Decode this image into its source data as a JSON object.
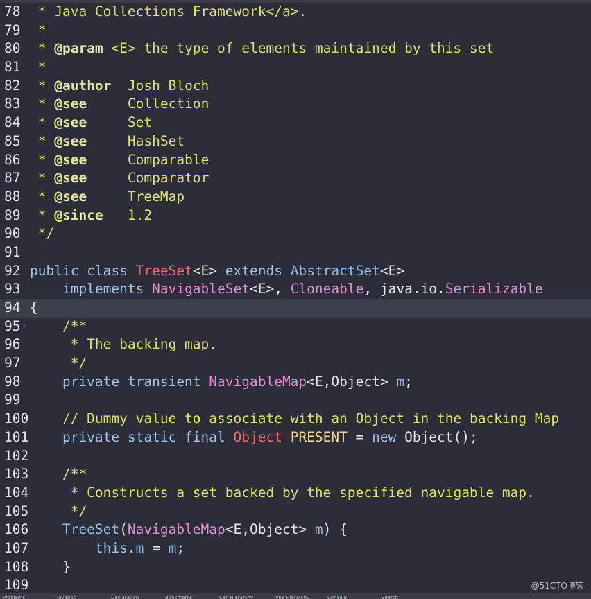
{
  "editor": {
    "lines": [
      {
        "num": "78",
        "fold": "",
        "segs": [
          {
            "t": " * Java Collections Framework</a>.",
            "c": "comment"
          }
        ]
      },
      {
        "num": "79",
        "fold": "",
        "segs": [
          {
            "t": " *",
            "c": "comment"
          }
        ]
      },
      {
        "num": "80",
        "fold": "",
        "segs": [
          {
            "t": " * ",
            "c": "comment"
          },
          {
            "t": "@param",
            "c": "tag"
          },
          {
            "t": " <E> the type of elements maintained by this set",
            "c": "comment"
          }
        ]
      },
      {
        "num": "81",
        "fold": "",
        "segs": [
          {
            "t": " *",
            "c": "comment"
          }
        ]
      },
      {
        "num": "82",
        "fold": "",
        "segs": [
          {
            "t": " * ",
            "c": "comment"
          },
          {
            "t": "@author",
            "c": "tag"
          },
          {
            "t": "  Josh Bloch",
            "c": "comment"
          }
        ]
      },
      {
        "num": "83",
        "fold": "",
        "segs": [
          {
            "t": " * ",
            "c": "comment"
          },
          {
            "t": "@see",
            "c": "tag"
          },
          {
            "t": "     Collection",
            "c": "comment"
          }
        ]
      },
      {
        "num": "84",
        "fold": "",
        "segs": [
          {
            "t": " * ",
            "c": "comment"
          },
          {
            "t": "@see",
            "c": "tag"
          },
          {
            "t": "     Set",
            "c": "comment"
          }
        ]
      },
      {
        "num": "85",
        "fold": "",
        "segs": [
          {
            "t": " * ",
            "c": "comment"
          },
          {
            "t": "@see",
            "c": "tag"
          },
          {
            "t": "     HashSet",
            "c": "comment"
          }
        ]
      },
      {
        "num": "86",
        "fold": "",
        "segs": [
          {
            "t": " * ",
            "c": "comment"
          },
          {
            "t": "@see",
            "c": "tag"
          },
          {
            "t": "     Comparable",
            "c": "comment"
          }
        ]
      },
      {
        "num": "87",
        "fold": "",
        "segs": [
          {
            "t": " * ",
            "c": "comment"
          },
          {
            "t": "@see",
            "c": "tag"
          },
          {
            "t": "     Comparator",
            "c": "comment"
          }
        ]
      },
      {
        "num": "88",
        "fold": "",
        "segs": [
          {
            "t": " * ",
            "c": "comment"
          },
          {
            "t": "@see",
            "c": "tag"
          },
          {
            "t": "     TreeMap",
            "c": "comment"
          }
        ]
      },
      {
        "num": "89",
        "fold": "",
        "segs": [
          {
            "t": " * ",
            "c": "comment"
          },
          {
            "t": "@since",
            "c": "tag"
          },
          {
            "t": "   1.2",
            "c": "comment"
          }
        ]
      },
      {
        "num": "90",
        "fold": "",
        "segs": [
          {
            "t": " */",
            "c": "comment"
          }
        ]
      },
      {
        "num": "91",
        "fold": "",
        "segs": []
      },
      {
        "num": "92",
        "fold": "",
        "segs": [
          {
            "t": "public class ",
            "c": "kw"
          },
          {
            "t": "TreeSet",
            "c": "red"
          },
          {
            "t": "<E> ",
            "c": "plain"
          },
          {
            "t": "extends ",
            "c": "kw"
          },
          {
            "t": "AbstractSet",
            "c": "var"
          },
          {
            "t": "<E>",
            "c": "plain"
          }
        ]
      },
      {
        "num": "93",
        "fold": "",
        "segs": [
          {
            "t": "    implements ",
            "c": "kw"
          },
          {
            "t": "NavigableSet",
            "c": "type"
          },
          {
            "t": "<E>, ",
            "c": "plain"
          },
          {
            "t": "Cloneable",
            "c": "type"
          },
          {
            "t": ", java.io.",
            "c": "plain"
          },
          {
            "t": "Serializable",
            "c": "type"
          }
        ]
      },
      {
        "num": "94",
        "fold": "",
        "current": true,
        "segs": [
          {
            "t": "{",
            "c": "plain"
          }
        ]
      },
      {
        "num": "95",
        "fold": "◦",
        "segs": [
          {
            "t": "    /**",
            "c": "comment"
          }
        ]
      },
      {
        "num": "96",
        "fold": "",
        "segs": [
          {
            "t": "     * The backing map.",
            "c": "comment"
          }
        ]
      },
      {
        "num": "97",
        "fold": "",
        "segs": [
          {
            "t": "     */",
            "c": "comment"
          }
        ]
      },
      {
        "num": "98",
        "fold": "",
        "segs": [
          {
            "t": "    private transient ",
            "c": "kw"
          },
          {
            "t": "NavigableMap",
            "c": "type"
          },
          {
            "t": "<E,Object> ",
            "c": "plain"
          },
          {
            "t": "m",
            "c": "var"
          },
          {
            "t": ";",
            "c": "plain"
          }
        ]
      },
      {
        "num": "99",
        "fold": "",
        "segs": []
      },
      {
        "num": "100",
        "fold": "",
        "segs": [
          {
            "t": "    // Dummy value to associate with an Object in the backing Map",
            "c": "comment"
          }
        ]
      },
      {
        "num": "101",
        "fold": "",
        "segs": [
          {
            "t": "    private static final ",
            "c": "kw"
          },
          {
            "t": "Object",
            "c": "red"
          },
          {
            "t": " ",
            "c": "plain"
          },
          {
            "t": "PRESENT",
            "c": "const"
          },
          {
            "t": " = ",
            "c": "plain"
          },
          {
            "t": "new ",
            "c": "kw"
          },
          {
            "t": "Object();",
            "c": "plain"
          }
        ]
      },
      {
        "num": "102",
        "fold": "",
        "segs": []
      },
      {
        "num": "103",
        "fold": "◦",
        "segs": [
          {
            "t": "    /**",
            "c": "comment"
          }
        ]
      },
      {
        "num": "104",
        "fold": "",
        "segs": [
          {
            "t": "     * Constructs a set backed by the specified navigable map.",
            "c": "comment"
          }
        ]
      },
      {
        "num": "105",
        "fold": "",
        "segs": [
          {
            "t": "     */",
            "c": "comment"
          }
        ]
      },
      {
        "num": "106",
        "fold": "◦",
        "segs": [
          {
            "t": "    TreeSet",
            "c": "var"
          },
          {
            "t": "(",
            "c": "plain"
          },
          {
            "t": "NavigableMap",
            "c": "type"
          },
          {
            "t": "<E,Object> ",
            "c": "plain"
          },
          {
            "t": "m",
            "c": "var"
          },
          {
            "t": ") {",
            "c": "plain"
          }
        ]
      },
      {
        "num": "107",
        "fold": "",
        "segs": [
          {
            "t": "        this",
            "c": "kw"
          },
          {
            "t": ".",
            "c": "plain"
          },
          {
            "t": "m",
            "c": "var"
          },
          {
            "t": " = ",
            "c": "plain"
          },
          {
            "t": "m",
            "c": "var"
          },
          {
            "t": ";",
            "c": "plain"
          }
        ]
      },
      {
        "num": "108",
        "fold": "",
        "segs": [
          {
            "t": "    }",
            "c": "plain"
          }
        ]
      },
      {
        "num": "109",
        "fold": "",
        "segs": []
      }
    ]
  },
  "watermark": "@51CTO博客",
  "bottom_tabs": [
    "Problems",
    "Javadoc",
    "Declaration",
    "Bookmarks",
    "Call Hierarchy",
    "Type Hierarchy",
    "Console",
    "Search"
  ]
}
